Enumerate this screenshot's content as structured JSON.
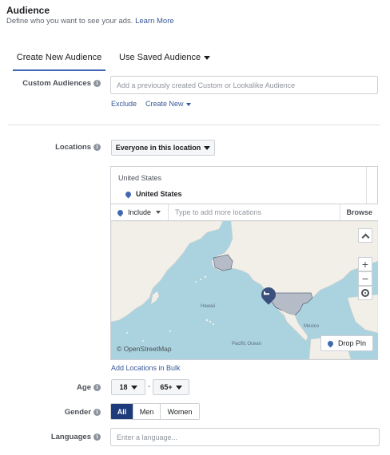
{
  "header": {
    "title": "Audience",
    "subtitle": "Define who you want to see your ads.",
    "learn_more": "Learn More"
  },
  "tabs": [
    {
      "label": "Create New Audience",
      "active": true
    },
    {
      "label": "Use Saved Audience",
      "active": false
    }
  ],
  "custom_audiences": {
    "label": "Custom Audiences",
    "placeholder": "Add a previously created Custom or Lookalike Audience",
    "exclude": "Exclude",
    "create_new": "Create New"
  },
  "locations": {
    "label": "Locations",
    "dropdown": "Everyone in this location",
    "country_header": "United States",
    "selected": "United States",
    "include": "Include",
    "placeholder": "Type to add more locations",
    "browse": "Browse",
    "attribution": "© OpenStreetMap",
    "drop_pin": "Drop Pin",
    "bulk": "Add Locations in Bulk",
    "map_labels": [
      "Hawaii",
      "Pacific Ocean",
      "Mexico"
    ]
  },
  "age": {
    "label": "Age",
    "min": "18",
    "separator": "-",
    "max": "65+"
  },
  "gender": {
    "label": "Gender",
    "options": [
      "All",
      "Men",
      "Women"
    ],
    "selected": "All"
  },
  "languages": {
    "label": "Languages",
    "placeholder": "Enter a language..."
  },
  "colors": {
    "accent": "#4267b2",
    "selected_dark": "#1d3a7a",
    "ocean": "#aad3df",
    "land": "#f2efe9"
  }
}
